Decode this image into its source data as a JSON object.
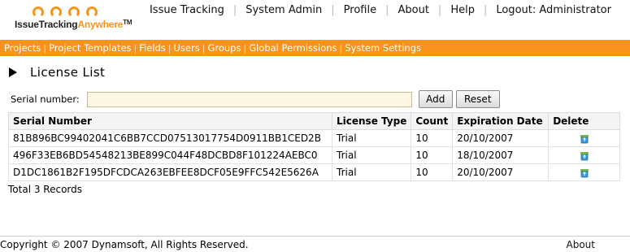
{
  "brand": {
    "logo_text_a": "IssueTracking",
    "logo_text_b": "Anywhere",
    "logo_tm": "TM",
    "accent_color": "#f7941d"
  },
  "topnav": [
    {
      "label": "Issue Tracking"
    },
    {
      "label": "System Admin"
    },
    {
      "label": "Profile"
    },
    {
      "label": "About"
    },
    {
      "label": "Help"
    },
    {
      "label": "Logout: Administrator"
    }
  ],
  "menu": [
    {
      "label": "Projects"
    },
    {
      "label": "Project Templates"
    },
    {
      "label": "Fields"
    },
    {
      "label": "Users"
    },
    {
      "label": "Groups"
    },
    {
      "label": "Global Permissions"
    },
    {
      "label": "System Settings"
    }
  ],
  "page": {
    "title": "License List"
  },
  "filter": {
    "label": "Serial number:",
    "value": "",
    "placeholder": "",
    "add_label": "Add",
    "reset_label": "Reset"
  },
  "table": {
    "headers": [
      "Serial Number",
      "License Type",
      "Count",
      "Expiration Date",
      "Delete"
    ],
    "rows": [
      {
        "serial": "81B896BC99402041C6BB7CCD07513017754D0911BB1CED2B",
        "type": "Trial",
        "count": "10",
        "expires": "20/10/2007"
      },
      {
        "serial": "496F33EB6BD54548213BE899C044F48DCBD8F101224AEBC0",
        "type": "Trial",
        "count": "10",
        "expires": "18/10/2007"
      },
      {
        "serial": "D1DC1861B2F195DFCDCA263EBFEE8DCF05E9FFC542E5626A",
        "type": "Trial",
        "count": "10",
        "expires": "20/10/2007"
      }
    ],
    "delete_icon": "recycle-bin-icon",
    "total": "Total 3 Records"
  },
  "footer": {
    "copyright": "Copyright © 2007 Dynamsoft, All Rights Reserved.",
    "about": "About"
  }
}
